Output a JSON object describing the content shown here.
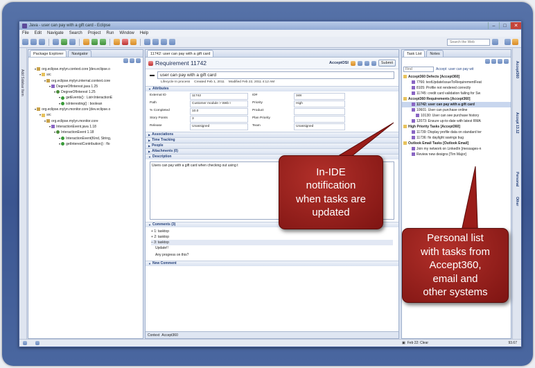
{
  "window": {
    "title": "Java - user can pay with a gift card - Eclipse",
    "controls": [
      "–",
      "□",
      "✕"
    ]
  },
  "menu": [
    "File",
    "Edit",
    "Navigate",
    "Search",
    "Project",
    "Run",
    "Window",
    "Help"
  ],
  "toolbar": {
    "search_placeholder": "Search the Web"
  },
  "left_strip_label": "Add Sidebar Item",
  "package_explorer": {
    "tabs": [
      "Package Explorer",
      "Navigator"
    ],
    "tree": [
      {
        "text": "org.eclipse.mylyn.context.core  [dev.eclipse.o",
        "indent": 1,
        "icon": "pk"
      },
      {
        "text": "src",
        "indent": 2,
        "icon": "f"
      },
      {
        "text": "org.eclipse.mylyn.internal.context.core",
        "indent": 3,
        "icon": "pk"
      },
      {
        "text": "DegreeOfInterest.java  1.25",
        "indent": 4,
        "icon": "t"
      },
      {
        "text": "DegreeOfInterest  1.25",
        "indent": 5,
        "icon": "cl"
      },
      {
        "text": "getEvents() : List<InteractionE",
        "indent": 6,
        "icon": "m"
      },
      {
        "text": "isInteresting() : boolean",
        "indent": 6,
        "icon": "m"
      },
      {
        "text": "org.eclipse.mylyn.monitor.core  [dev.eclipse.o",
        "indent": 1,
        "icon": "pk"
      },
      {
        "text": "src",
        "indent": 2,
        "icon": "f"
      },
      {
        "text": "org.eclipse.mylyn.monitor.core",
        "indent": 3,
        "icon": "pk"
      },
      {
        "text": "InteractionEvent.java  1.18",
        "indent": 4,
        "icon": "t"
      },
      {
        "text": "InteractionEvent  1.18",
        "indent": 5,
        "icon": "cl"
      },
      {
        "text": "InteractionEvent(Kind, String,",
        "indent": 6,
        "icon": "m"
      },
      {
        "text": "getInterestContribution() : flo",
        "indent": 6,
        "icon": "m"
      }
    ]
  },
  "editor": {
    "tab": "11742: user can pay with a gift card",
    "title": "Requirement 11742",
    "connector": "AcceptOSI",
    "submit": "Submit",
    "summary": "user can pay with a gift card",
    "lifecycle": {
      "label": "Lifecycle",
      "state": "In process",
      "created_label": "Created",
      "created": "Feb 1, 2011",
      "modified_label": "Modified",
      "modified": "Feb 22, 2011 4:12 AM"
    },
    "sections": {
      "attributes": "Attributes",
      "associations": "Associations",
      "time_tracking": "Time Tracking",
      "people": "People",
      "attachments": "Attachments (0)",
      "description": "Description",
      "comments": "Comments (3)",
      "new_comment": "New Comment"
    },
    "attributes": [
      {
        "label": "External ID",
        "value": "11742",
        "label2": "ID#",
        "value2": "348"
      },
      {
        "label": "Path",
        "value": "Customer module > Web I",
        "label2": "Priority",
        "value2": "High"
      },
      {
        "label": "% Completed",
        "value": "10.0",
        "label2": "Product",
        "value2": ""
      },
      {
        "label": "Story Points",
        "value": "3",
        "label2": "Plan Priority",
        "value2": ""
      },
      {
        "label": "Release",
        "value": "Unassigned",
        "label2": "Team",
        "value2": "Unassigned"
      }
    ],
    "description": "Users can pay with a gift card when checking out using t",
    "comments": [
      {
        "label": "1: tasktop"
      },
      {
        "label": "2: tasktop"
      },
      {
        "label": "3: tasktop",
        "body": "Update!!",
        "body2": "Any progress on this?"
      }
    ],
    "bottom_tabs": [
      "Context",
      "Accept360"
    ]
  },
  "task_list": {
    "tabs": [
      "Task List",
      "Notes"
    ],
    "find_placeholder": "Find",
    "filter": "Accept",
    "path": "user can pay wit",
    "rows": [
      {
        "text": "Accept360 Defects  [Accept360]",
        "bold": true,
        "indent": 0
      },
      {
        "text": "7766: textUpdateIssueToRequirementFeat",
        "indent": 2
      },
      {
        "text": "8105: Profile not rendered correctly",
        "indent": 2
      },
      {
        "text": "11745: credit card validation failing for Sw",
        "indent": 2
      },
      {
        "text": "Accept360 Requirements  [Accept360]",
        "bold": true,
        "indent": 0
      },
      {
        "text": "11742: user can pay with a gift card",
        "bold": true,
        "indent": 2,
        "selected": true
      },
      {
        "text": "10601: User can purchase online",
        "indent": 2
      },
      {
        "text": "10130: User can see purchase history",
        "indent": 3
      },
      {
        "text": "12073: Ensure up-to-date with latest RMA",
        "indent": 2
      },
      {
        "text": "High Priority Tasks  [Accept360]",
        "bold": true,
        "indent": 0
      },
      {
        "text": "11739: Display profile data on standard ter",
        "indent": 2
      },
      {
        "text": "11736: fix daylight savings bug",
        "indent": 2
      },
      {
        "text": "Outlook Email Tasks  [Outlook Email]",
        "bold": true,
        "indent": 0
      },
      {
        "text": "Join my network on LinkedIn [messages-n",
        "indent": 2
      },
      {
        "text": "Review new designs [Tim Major]",
        "indent": 2
      }
    ]
  },
  "right_strip": [
    "Accept360",
    "Accept 13.12",
    "Personal",
    "Other"
  ],
  "status": {
    "date": "Feb 22: Clear",
    "memory": "93.67"
  },
  "callouts": {
    "ide": "In-IDE\nnotification\nwhen tasks are\nupdated",
    "personal": "Personal list\nwith tasks from\nAccept360,\nemail and\nother systems"
  },
  "colors": {
    "callout": "#8e1a17",
    "frame": "#3b5590",
    "selected": "#c8d6ee"
  }
}
